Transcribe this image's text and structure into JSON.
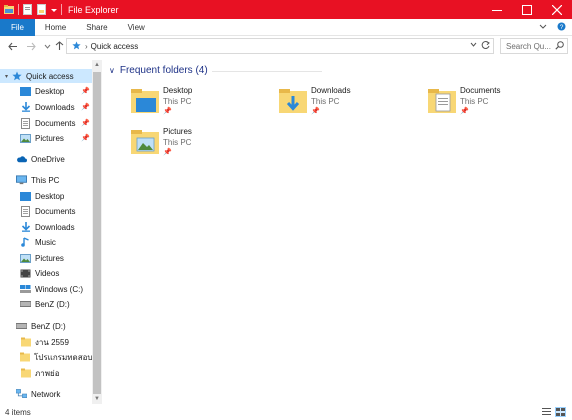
{
  "window": {
    "title": "File Explorer",
    "accent_color": "#e81123",
    "controls": [
      "minimize",
      "maximize",
      "close"
    ]
  },
  "ribbon": {
    "tabs": [
      "File",
      "Home",
      "Share",
      "View"
    ],
    "file_tab_color": "#1979ca"
  },
  "address": {
    "breadcrumb": "Quick access",
    "search_placeholder": "Search Qu..."
  },
  "nav": {
    "quick_access": "Quick access",
    "qa_items": [
      "Desktop",
      "Downloads",
      "Documents",
      "Pictures"
    ],
    "onedrive": "OneDrive",
    "this_pc": "This PC",
    "pc_items": [
      "Desktop",
      "Documents",
      "Downloads",
      "Music",
      "Pictures",
      "Videos",
      "Windows (C:)",
      "BenZ (D:)"
    ],
    "drive": "BenZ (D:)",
    "drive_items": [
      "งาน 2559",
      "โปรแกรมทดสอบ N",
      "ภาพย่อ"
    ],
    "network": "Network"
  },
  "content": {
    "group_title": "Frequent folders (4)",
    "folders": [
      {
        "name": "Desktop",
        "location": "This PC",
        "icon": "desktop-folder-icon"
      },
      {
        "name": "Downloads",
        "location": "This PC",
        "icon": "downloads-folder-icon"
      },
      {
        "name": "Documents",
        "location": "This PC",
        "icon": "documents-folder-icon"
      },
      {
        "name": "Pictures",
        "location": "This PC",
        "icon": "pictures-folder-icon"
      }
    ]
  },
  "status": {
    "item_count": "4 items"
  }
}
